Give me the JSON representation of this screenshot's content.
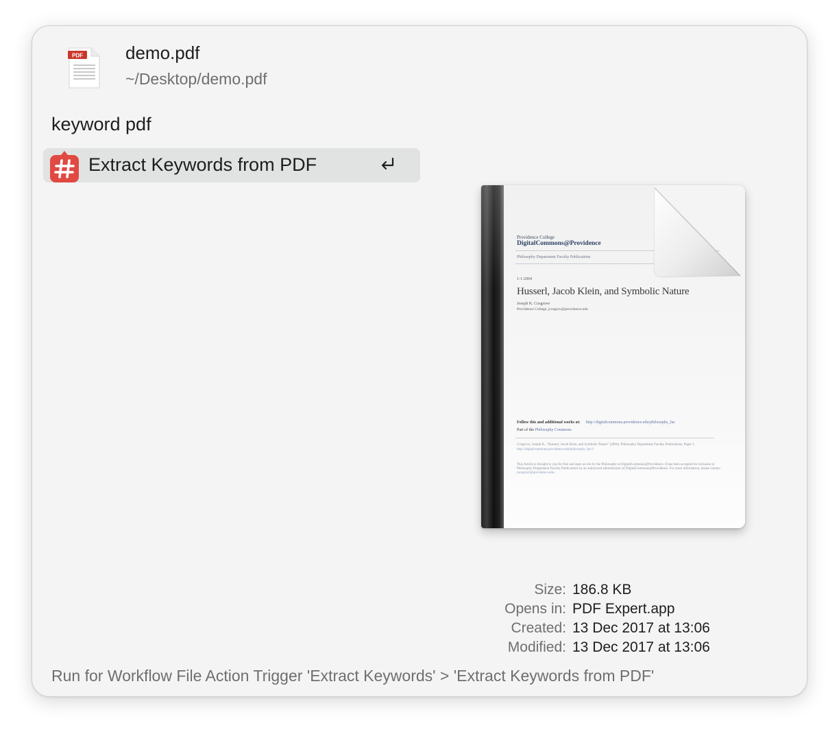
{
  "file": {
    "name": "demo.pdf",
    "path": "~/Desktop/demo.pdf",
    "icon": "pdf-file-icon",
    "icon_badge": "PDF"
  },
  "query": "keyword pdf",
  "results": [
    {
      "label": "Extract Keywords from PDF",
      "icon": "hashtag-icon",
      "icon_color": "#e04a43",
      "selected": true,
      "action_icon": "return-key-icon"
    }
  ],
  "preview": {
    "page": {
      "institution": "Providence College",
      "repository": "DigitalCommons@Providence",
      "collection": "Philosophy Department Faculty Publications",
      "date": "1-1-2004",
      "title": "Husserl, Jacob Klein, and Symbolic Nature",
      "author": "Joseph K. Cosgrove",
      "affiliation": "Providence College, jcosgrov@providence.edu",
      "follow_text": "Follow this and additional works at:",
      "follow_link": "http://digitalcommons.providence.edu/philosophy_fac",
      "part_of_prefix": "Part of the",
      "part_of_link": "Philosophy Commons",
      "citation": "Cosgrove, Joseph K., \"Husserl, Jacob Klein, and Symbolic Nature\" (2004). Philosophy Department Faculty Publications. Paper 1.",
      "citation_link": "http://digitalcommons.providence.edu/philosophy_fac/1",
      "notice_1": "This Article is brought to you for free and open access by the Philosophy at DigitalCommons@Providence. It has been accepted for inclusion in",
      "notice_2": "Philosophy Department Faculty Publications by an authorized administrator of DigitalCommons@Providence. For more information, please contact",
      "notice_3": "mcaprio1@providence.edu."
    }
  },
  "details": [
    {
      "label": "Size:",
      "value": "186.8 KB"
    },
    {
      "label": "Opens in:",
      "value": "PDF Expert.app"
    },
    {
      "label": "Created:",
      "value": "13 Dec 2017 at 13:06"
    },
    {
      "label": "Modified:",
      "value": "13 Dec 2017 at 13:06"
    }
  ],
  "footer": "Run for Workflow File Action Trigger 'Extract Keywords' > 'Extract Keywords from PDF'",
  "colors": {
    "panel_bg": "#f3f4f3",
    "selection_bg": "#e1e2e2",
    "pdf_badge": "#c9382c"
  }
}
